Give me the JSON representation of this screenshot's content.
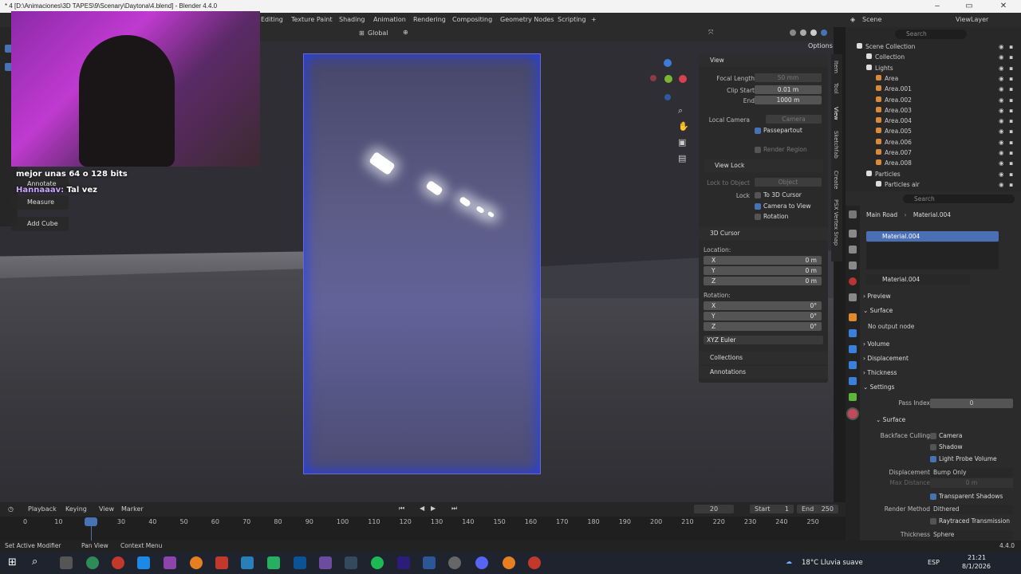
{
  "window": {
    "title": "* 4 [D:\\Animaciones\\3D TAPES\\9\\Scenary\\Daytona\\4.blend] - Blender 4.4.0"
  },
  "workspace_tabs": [
    "Editing",
    "Texture Paint",
    "Shading",
    "Animation",
    "Rendering",
    "Compositing",
    "Geometry Nodes",
    "Scripting",
    "+"
  ],
  "viewport_header": {
    "orientation": "Global",
    "options": "Options"
  },
  "scene": {
    "scene_label": "Scene",
    "viewlayer_label": "ViewLayer"
  },
  "overlay": {
    "chat1": "mejor unas 64 o 128 bits",
    "chat2_user": "Hannaaav:",
    "chat2_msg": "Tal vez",
    "tools": [
      "Annotate",
      "Measure",
      "Add Cube"
    ]
  },
  "npanel": {
    "tabs": [
      "Item",
      "Tool",
      "View",
      "Sketchfab",
      "Create",
      "PSX Vertex Snap"
    ],
    "view": {
      "header": "View",
      "focal_label": "Focal Length",
      "focal_value": "50 mm",
      "clip_start_label": "Clip Start",
      "clip_start_value": "0.01 m",
      "end_label": "End",
      "end_value": "1000 m",
      "local_camera_label": "Local Camera",
      "local_camera_value": "Camera",
      "passepartout": "Passepartout",
      "render_region": "Render Region"
    },
    "view_lock": {
      "header": "View Lock",
      "lock_to_object_label": "Lock to Object",
      "lock_to_object_value": "Object",
      "lock_label": "Lock",
      "to_3d_cursor": "To 3D Cursor",
      "camera_to_view": "Camera to View",
      "rotation": "Rotation"
    },
    "cursor": {
      "header": "3D Cursor",
      "location": "Location:",
      "x": "X",
      "y": "Y",
      "z": "Z",
      "lx": "0 m",
      "ly": "0 m",
      "lz": "0 m",
      "rotation": "Rotation:",
      "rx": "0°",
      "ry": "0°",
      "rz": "0°",
      "mode": "XYZ Euler"
    },
    "collections": "Collections",
    "annotations": "Annotations"
  },
  "outliner": {
    "search": "Search",
    "rows": [
      {
        "label": "Scene Collection",
        "depth": 0
      },
      {
        "label": "Collection",
        "depth": 1
      },
      {
        "label": "Lights",
        "depth": 1
      },
      {
        "label": "Area",
        "depth": 2
      },
      {
        "label": "Area.001",
        "depth": 2
      },
      {
        "label": "Area.002",
        "depth": 2
      },
      {
        "label": "Area.003",
        "depth": 2
      },
      {
        "label": "Area.004",
        "depth": 2
      },
      {
        "label": "Area.005",
        "depth": 2
      },
      {
        "label": "Area.006",
        "depth": 2
      },
      {
        "label": "Area.007",
        "depth": 2
      },
      {
        "label": "Area.008",
        "depth": 2
      },
      {
        "label": "Particles",
        "depth": 1
      },
      {
        "label": "Particles air",
        "depth": 2
      }
    ]
  },
  "properties": {
    "search": "Search",
    "breadcrumb_object": "Main Road",
    "breadcrumb_material": "Material.004",
    "slot": "Material.004",
    "material_name": "Material.004",
    "sections": {
      "preview": "Preview",
      "surface": "Surface",
      "no_output": "No output node",
      "volume": "Volume",
      "displacement": "Displacement",
      "thickness": "Thickness",
      "settings": "Settings",
      "surface_sub": "Surface"
    },
    "pass_index_label": "Pass Index",
    "pass_index_value": "0",
    "backface_label": "Backface Culling",
    "camera": "Camera",
    "shadow": "Shadow",
    "light_probe": "Light Probe Volume",
    "displacement_label": "Displacement",
    "displacement_value": "Bump Only",
    "max_distance_label": "Max Distance",
    "max_distance_value": "0 m",
    "transparent_shadows": "Transparent Shadows",
    "render_method_label": "Render Method",
    "render_method_value": "Dithered",
    "raytraced": "Raytraced Transmission",
    "thickness_label": "Thickness",
    "thickness_value": "Sphere"
  },
  "timeline": {
    "menus": [
      "Playback",
      "Keying",
      "View",
      "Marker"
    ],
    "current_frame": "20",
    "start_label": "Start",
    "start_value": "1",
    "end_label": "End",
    "end_value": "250",
    "ticks": [
      "0",
      "10",
      "20",
      "30",
      "40",
      "50",
      "60",
      "70",
      "80",
      "90",
      "100",
      "110",
      "120",
      "130",
      "140",
      "150",
      "160",
      "170",
      "180",
      "190",
      "200",
      "210",
      "220",
      "230",
      "240",
      "250"
    ]
  },
  "statusbar": {
    "set_active_modifier": "Set Active Modifier",
    "pan_view": "Pan View",
    "context_menu": "Context Menu",
    "version": "4.4.0"
  },
  "taskbar": {
    "weather": "18°C  Lluvia suave",
    "lang": "ESP",
    "time": "21:21",
    "date": "8/1/2026"
  },
  "colors": {
    "accent": "#4772b3",
    "select": "#4a6fb5",
    "bg": "#1d1d1d",
    "camera_frame": "#6b6bbf"
  }
}
